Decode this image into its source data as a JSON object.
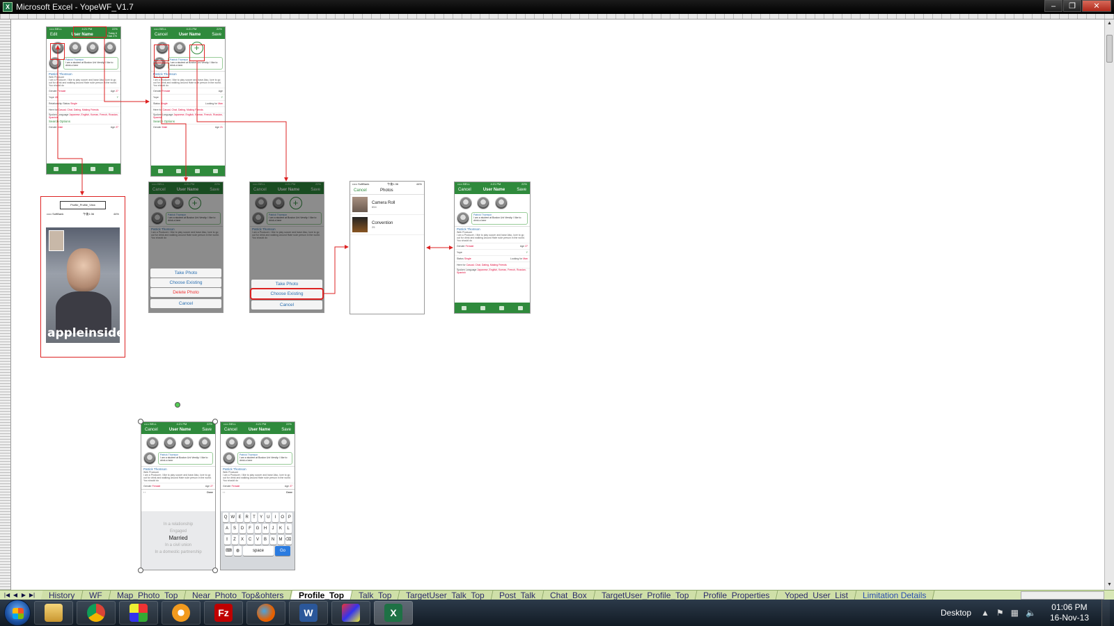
{
  "window": {
    "title": "Microsoft Excel - YopeWF_V1.7",
    "controls": [
      "–",
      "❐",
      "✕"
    ]
  },
  "mock": {
    "status_left": "••••• BELL",
    "status_time": "4:21 PM",
    "status_right": "22%",
    "edit": "Edit",
    "user_name": "User Name",
    "today": "Today 6",
    "total": "Total 270",
    "cancel": "Cancel",
    "save": "Save",
    "name": "Patrick Thomson",
    "title_role": "Web Producer",
    "bio_short": "I am a student at Boston Uni Versity. I like to drink a beer",
    "bio_long": "I am a Producer. I like to play soccer and base Also, love to go out for drink and walking around Hate rude person in the world. You should do",
    "gender_label": "Gender",
    "gender_val": "Female",
    "age_label": "Age",
    "age_val": "27",
    "yope_label": "Yope",
    "yope_val": "40",
    "rel_label": "Relationship Status",
    "rel_val": "Single",
    "status_label": "Status",
    "looking_label": "Looking for",
    "looking_val": "Man",
    "here_label": "Here for",
    "here_val": "Casual, Chat, Dating, Making Friends",
    "lang_label": "Spoken Language",
    "lang_val": "Japanese, English, Korean, French, Russian, Spanish",
    "search_options": "Search Options",
    "gender_male": "Male",
    "age_21": "21",
    "take_photo": "Take Photo",
    "choose_existing": "Choose Existing",
    "delete_photo": "Delete Photo",
    "photos_title": "Photos",
    "camera_roll": "Camera Roll",
    "camera_roll_count": "654",
    "convention": "Convention",
    "convention_count": "25",
    "softbank": "••••• SoftBank",
    "softbank_time": "午後1:36",
    "softbank_batt": "44%",
    "profile_view_label": "Profile_Profile_View",
    "appleinsider": "appleinsider",
    "done": "Done",
    "picker": [
      "In a relationship",
      "Engaged",
      "Married",
      "In a civil union",
      "In a domestic partnership"
    ],
    "picker_selected": "Married",
    "keys_row1": [
      "Q",
      "W",
      "E",
      "R",
      "T",
      "Y",
      "U",
      "I",
      "O",
      "P"
    ],
    "keys_row2": [
      "A",
      "S",
      "D",
      "F",
      "G",
      "H",
      "J",
      "K",
      "L"
    ],
    "keys_row3": [
      "⇧",
      "Z",
      "X",
      "C",
      "V",
      "B",
      "N",
      "M",
      "⌫"
    ],
    "space": "space",
    "go": "Go"
  },
  "sheet_tabs": [
    {
      "label": "History",
      "active": false
    },
    {
      "label": "WF",
      "active": false
    },
    {
      "label": "Map_Photo_Top",
      "active": false
    },
    {
      "label": "Near_Photo_Top&ohters",
      "active": false
    },
    {
      "label": "Profile_Top",
      "active": true
    },
    {
      "label": "Talk_Top",
      "active": false
    },
    {
      "label": "TargetUser_Talk_Top",
      "active": false
    },
    {
      "label": "Post_Talk",
      "active": false
    },
    {
      "label": "Chat_Box",
      "active": false
    },
    {
      "label": "TargetUser_Profile_Top",
      "active": false
    },
    {
      "label": "Profile_Properties",
      "active": false
    },
    {
      "label": "Yoped_User_List",
      "active": false
    },
    {
      "label": "Limitation Details",
      "active": false,
      "blue": true
    }
  ],
  "taskbar": {
    "apps": [
      "explorer-icon",
      "chrome-icon",
      "apps-icon",
      "settings-icon",
      "filezilla-icon",
      "firefox-icon",
      "word-icon",
      "paint-icon",
      "excel-icon"
    ],
    "desktop": "Desktop",
    "time": "01:06 PM",
    "date": "16-Nov-13"
  },
  "colors": {
    "accent_green": "#2f8a3c",
    "arrow_red": "#d22222"
  }
}
